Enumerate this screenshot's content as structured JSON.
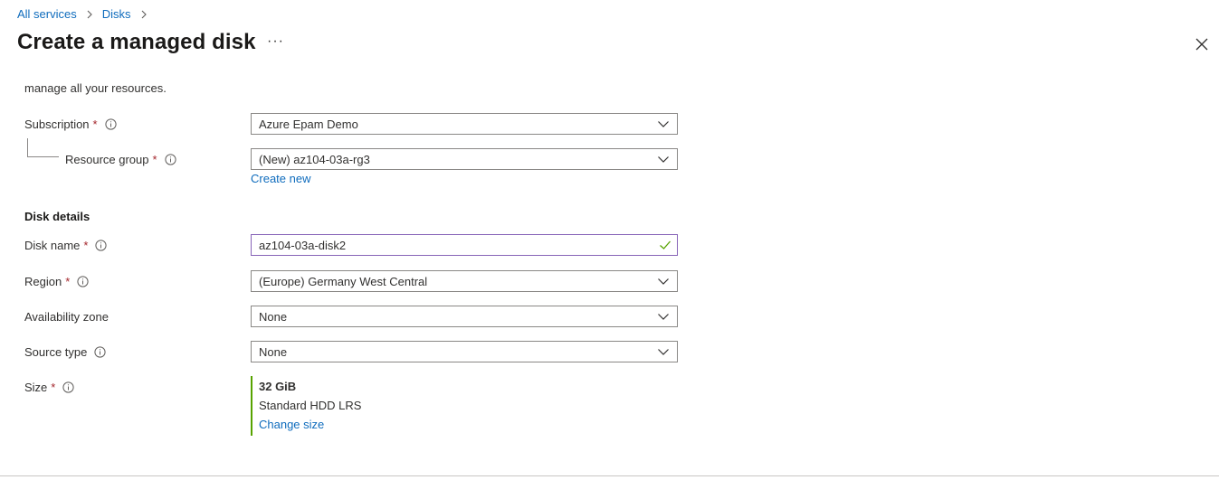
{
  "breadcrumb": {
    "items": [
      "All services",
      "Disks"
    ]
  },
  "page": {
    "title": "Create a managed disk",
    "more_label": "···"
  },
  "intro_text": "manage all your resources.",
  "project": {
    "subscription_label": "Subscription",
    "subscription_value": "Azure Epam Demo",
    "resource_group_label": "Resource group",
    "resource_group_value": "(New) az104-03a-rg3",
    "create_new_link": "Create new"
  },
  "disk_details": {
    "heading": "Disk details",
    "disk_name_label": "Disk name",
    "disk_name_value": "az104-03a-disk2",
    "region_label": "Region",
    "region_value": "(Europe) Germany West Central",
    "availability_zone_label": "Availability zone",
    "availability_zone_value": "None",
    "source_type_label": "Source type",
    "source_type_value": "None",
    "size_label": "Size",
    "size_value": "32 GiB",
    "size_sku": "Standard HDD LRS",
    "change_size_link": "Change size"
  },
  "required_mark": "*",
  "colors": {
    "link": "#0f6cbd",
    "required": "#a4262c",
    "size_accent": "#57a300",
    "valid_check": "#57a300",
    "focused_border": "#8764b8"
  },
  "icons": [
    "chevron-right-icon",
    "more-icon",
    "close-icon",
    "info-icon",
    "chevron-down-icon",
    "checkmark-icon"
  ]
}
